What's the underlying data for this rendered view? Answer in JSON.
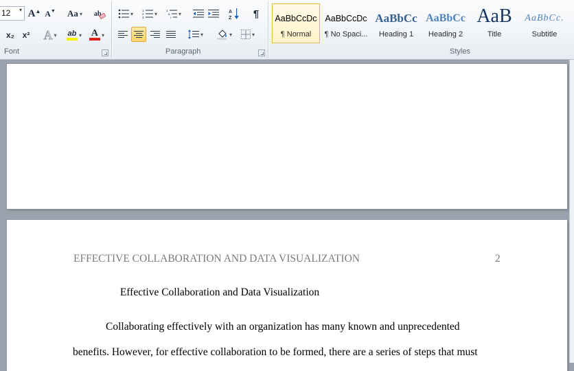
{
  "ribbon": {
    "font_group": {
      "label": "Font",
      "font_size": "12",
      "grow_label": "A",
      "shrink_label": "A",
      "change_case_label": "Aa",
      "subscript_label": "x₂",
      "superscript_label": "x²",
      "text_effects_label": "A",
      "highlight_label": "ab",
      "font_color_label": "A",
      "highlight_color": "#f7f300",
      "font_color": "#e0201a"
    },
    "paragraph_group": {
      "label": "Paragraph",
      "sort_label": "A↓Z",
      "pilcrow_label": "¶",
      "active_alignment": "center"
    },
    "styles_group": {
      "label": "Styles",
      "styles": [
        {
          "sample": "AaBbCcDc",
          "name": "¶ Normal",
          "selected": true
        },
        {
          "sample": "AaBbCcDc",
          "name": "¶ No Spaci...",
          "selected": false
        },
        {
          "sample": "AaBbCc",
          "name": "Heading 1",
          "selected": false
        },
        {
          "sample": "AaBbCc",
          "name": "Heading 2",
          "selected": false
        },
        {
          "sample": "AaB",
          "name": "Title",
          "selected": false
        },
        {
          "sample": "AaBbCc.",
          "name": "Subtitle",
          "selected": false
        }
      ]
    }
  },
  "document": {
    "running_head": "EFFECTIVE COLLABORATION AND DATA VISUALIZATION",
    "page_number": "2",
    "title": "Effective Collaboration and Data Visualization",
    "paragraph_lines": [
      "Collaborating effectively with an organization has many known and unprecedented",
      "benefits. However, for effective collaboration to be formed, there are a series of steps that must"
    ]
  }
}
